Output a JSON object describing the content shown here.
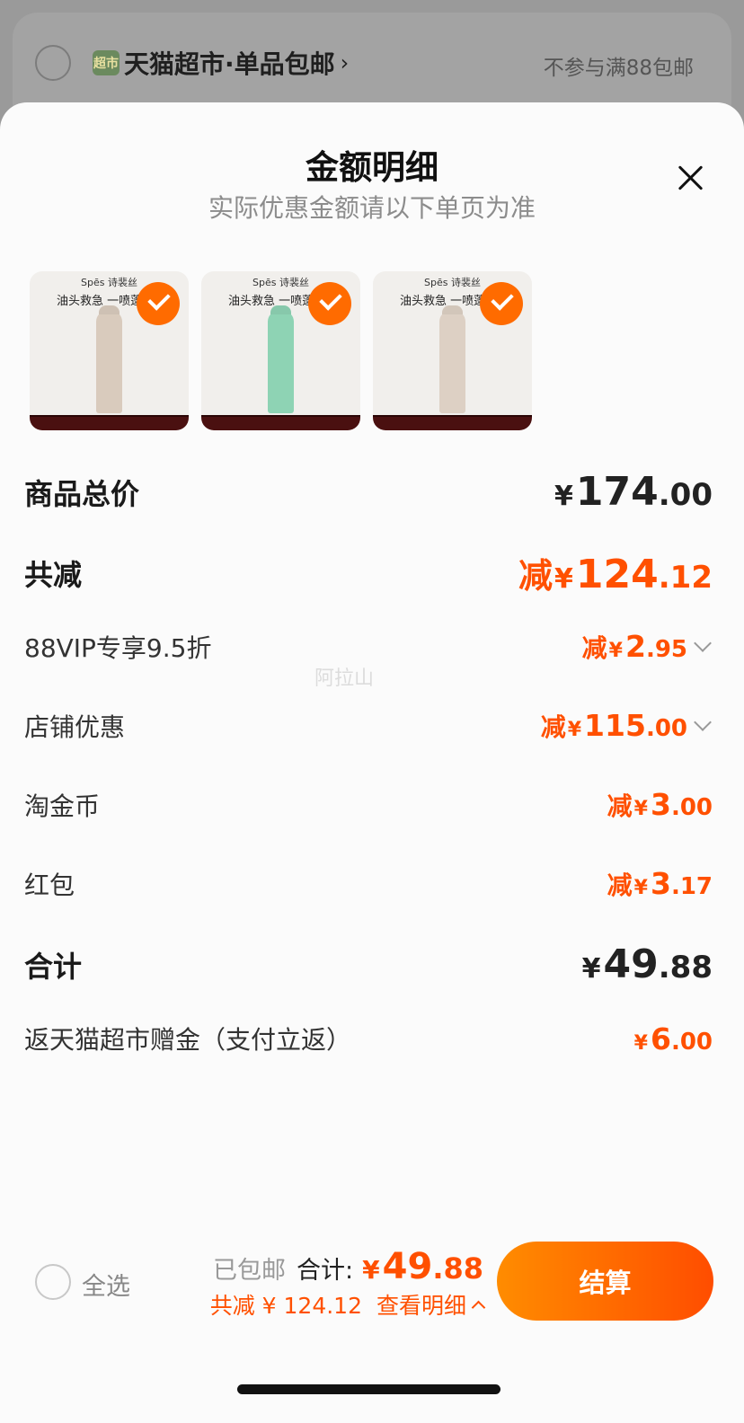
{
  "store": {
    "badge": "超市",
    "name": "天猫超市·单品包邮",
    "chevron": "›",
    "note": "不参与满88包邮"
  },
  "sheet": {
    "title": "金额明细",
    "subtitle": "实际优惠金额请以下单页为准",
    "close_icon": "close-icon"
  },
  "products": [
    {
      "brand": "Spēs 诗裴丝",
      "tagline": "油头救急 一喷蓬",
      "bottle_color": "#d9cbbd",
      "selected": true
    },
    {
      "brand": "Spēs 诗裴丝",
      "tagline": "油头救急 一喷蓬",
      "bottle_color": "#8ed3b4",
      "selected": true
    },
    {
      "brand": "Spēs 诗裴丝",
      "tagline": "油头救急 一喷蓬",
      "bottle_color": "#ddd0c4",
      "selected": true
    }
  ],
  "breakdown": {
    "goods_total": {
      "label": "商品总价",
      "yen": "¥",
      "int": "174",
      "dec": ".00"
    },
    "total_reduce": {
      "label": "共减",
      "prefix": "减",
      "yen": "¥",
      "int": "124",
      "dec": ".12"
    },
    "vip": {
      "label": "88VIP专享9.5折",
      "prefix": "减",
      "yen": "¥",
      "int": "2",
      "dec": ".95"
    },
    "shop": {
      "label": "店铺优惠",
      "prefix": "减",
      "yen": "¥",
      "int": "115",
      "dec": ".00"
    },
    "coins": {
      "label": "淘金币",
      "prefix": "减",
      "yen": "¥",
      "int": "3",
      "dec": ".00"
    },
    "redpacket": {
      "label": "红包",
      "prefix": "减",
      "yen": "¥",
      "int": "3",
      "dec": ".17"
    },
    "sum": {
      "label": "合计",
      "yen": "¥",
      "int": "49",
      "dec": ".88"
    },
    "rebate": {
      "label": "返天猫超市赠金（支付立返）",
      "yen": "¥",
      "int": "6",
      "dec": ".00"
    }
  },
  "watermark": "阿拉山",
  "bottom_bar": {
    "select_all": "全选",
    "shipping": "已包邮",
    "total_label": "合计:",
    "total_yen": "¥",
    "total_int": "49",
    "total_dec": ".88",
    "reduce_text": "共减 ¥ 124.12",
    "detail_text": "查看明细",
    "checkout": "结算"
  },
  "colors": {
    "accent": "#ff5000",
    "check": "#ff6b00",
    "checkout_start": "#ff8c00",
    "checkout_end": "#ff4d00"
  }
}
